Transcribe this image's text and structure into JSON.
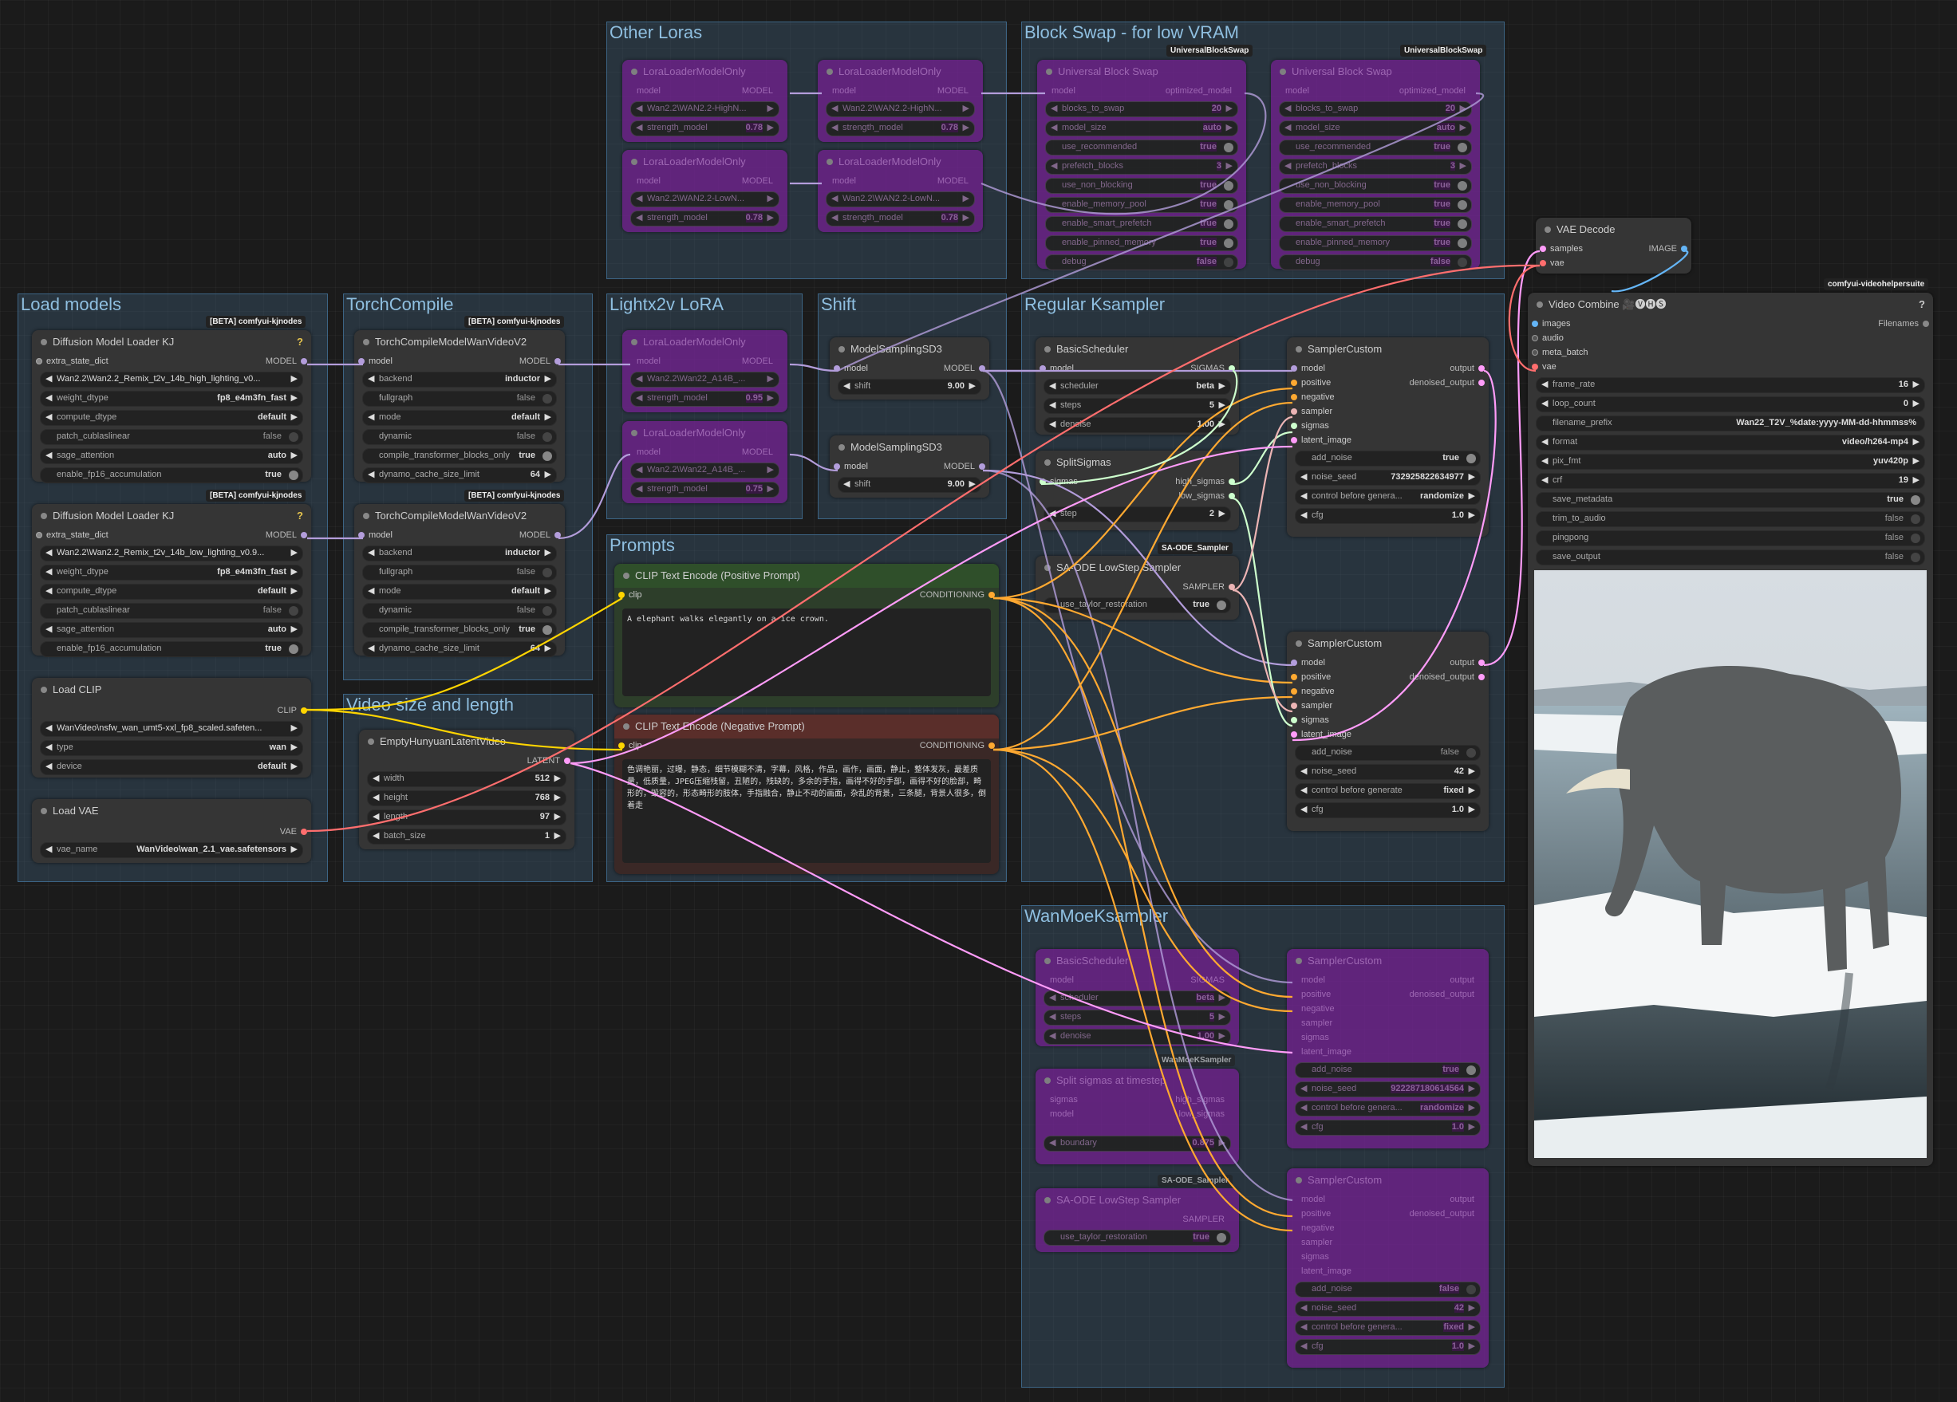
{
  "groups": {
    "other_loras": "Other Loras",
    "block_swap": "Block Swap - for low VRAM",
    "load_models": "Load models",
    "torch_compile": "TorchCompile",
    "lightx2v": "Lightx2v LoRA",
    "shift": "Shift",
    "regular_ksampler": "Regular Ksampler",
    "prompts": "Prompts",
    "video_size": "Video size and length",
    "wanmoe": "WanMoeKsampler"
  },
  "badges": {
    "kj": "[BETA] comfyui-kjnodes",
    "vhs": "comfyui-videohelpersuite",
    "ubs": "UniversalBlockSwap",
    "sa_ode": "SA-ODE_Sampler",
    "wanmoe": "WanMoeKSampler"
  },
  "sockets": {
    "model": "model",
    "MODEL": "MODEL",
    "clip": "clip",
    "CLIP": "CLIP",
    "vae": "vae",
    "VAE": "VAE",
    "LATENT": "LATENT",
    "CONDITIONING": "CONDITIONING",
    "SIGMAS": "SIGMAS",
    "SAMPLER": "SAMPLER",
    "IMAGE": "IMAGE",
    "samples": "samples",
    "sigmas": "sigmas",
    "output": "output",
    "denoised_output": "denoised_output",
    "positive": "positive",
    "negative": "negative",
    "sampler": "sampler",
    "latent_image": "latent_image",
    "optimized_model": "optimized_model",
    "extra_state_dict": "extra_state_dict",
    "high_sigmas": "high_sigmas",
    "low_sigmas": "low_sigmas",
    "images": "images",
    "audio": "audio",
    "meta_batch": "meta_batch",
    "Filenames": "Filenames"
  },
  "lora_loader": {
    "title": "LoraLoaderModelOnly",
    "n1": "Wan2.2\\WAN2.2-HighN...",
    "n2": "Wan2.2\\WAN2.2-LowN...",
    "strength_label": "strength_model",
    "s1": "0.78",
    "s2": "0.78"
  },
  "lightx2v": {
    "title": "LoraLoaderModelOnly",
    "n1": "Wan2.2\\Wan22_A14B_...",
    "n2": "Wan2.2\\Wan22_A14B_...",
    "strength_label": "strength_model",
    "s1": "0.95",
    "s2": "0.75"
  },
  "block_swap": {
    "title": "Universal Block Swap",
    "blocks_to_swap": "blocks_to_swap",
    "bts_val": "20",
    "model_size": "model_size",
    "model_size_val": "auto",
    "use_recommended": "use_recommended",
    "prefetch_blocks": "prefetch_blocks",
    "prefetch_val": "3",
    "use_non_blocking": "use_non_blocking",
    "enable_memory_pool": "enable_memory_pool",
    "enable_smart_prefetch": "enable_smart_prefetch",
    "enable_pinned_memory": "enable_pinned_memory",
    "debug": "debug",
    "true": "true",
    "false": "false"
  },
  "dml1": {
    "title": "Diffusion Model Loader KJ",
    "model": "Wan2.2\\Wan2.2_Remix_t2v_14b_high_lighting_v0...",
    "weight_dtype": "fp8_e4m3fn_fast",
    "compute_dtype": "default",
    "patch_cublaslinear": "false",
    "sage_attention": "auto",
    "enable_fp16_accumulation": "true"
  },
  "dml2": {
    "title": "Diffusion Model Loader KJ",
    "model": "Wan2.2\\Wan2.2_Remix_t2v_14b_low_lighting_v0.9...",
    "weight_dtype": "fp8_e4m3fn_fast",
    "compute_dtype": "default",
    "patch_cublaslinear": "false",
    "sage_attention": "auto",
    "enable_fp16_accumulation": "true"
  },
  "labels": {
    "weight_dtype": "weight_dtype",
    "compute_dtype": "compute_dtype",
    "patch_cublaslinear": "patch_cublaslinear",
    "sage_attention": "sage_attention",
    "enable_fp16_accumulation": "enable_fp16_accumulation",
    "backend": "backend",
    "fullgraph": "fullgraph",
    "mode": "mode",
    "dynamic": "dynamic",
    "compile_transformer_blocks_only": "compile_transformer_blocks_only",
    "dynamo_cache_size_limit": "dynamo_cache_size_limit",
    "type": "type",
    "device": "device",
    "vae_name": "vae_name",
    "width": "width",
    "height": "height",
    "length": "length",
    "batch_size": "batch_size",
    "shift": "shift",
    "scheduler": "scheduler",
    "steps": "steps",
    "denoise": "denoise",
    "step": "step",
    "use_taylor_restoration": "use_taylor_restoration",
    "add_noise": "add_noise",
    "noise_seed": "noise_seed",
    "control_before_generate": "control before genera...",
    "control_before_generate_full": "control before generate",
    "cfg": "cfg",
    "frame_rate": "frame_rate",
    "loop_count": "loop_count",
    "filename_prefix": "filename_prefix",
    "format": "format",
    "pix_fmt": "pix_fmt",
    "crf": "crf",
    "save_metadata": "save_metadata",
    "trim_to_audio": "trim_to_audio",
    "pingpong": "pingpong",
    "save_output": "save_output",
    "boundary": "boundary"
  },
  "tc": {
    "title": "TorchCompileModelWanVideoV2",
    "backend": "inductor",
    "fullgraph": "false",
    "mode": "default",
    "dynamic": "false",
    "ctbo": "true",
    "dcsl": "64"
  },
  "load_clip": {
    "title": "Load CLIP",
    "clip_name": "WanVideo\\nsfw_wan_umt5-xxl_fp8_scaled.safeten...",
    "type": "wan",
    "device": "default"
  },
  "load_vae": {
    "title": "Load VAE",
    "vae_name": "WanVideo\\wan_2.1_vae.safetensors"
  },
  "latent": {
    "title": "EmptyHunyuanLatentVideo",
    "width": "512",
    "height": "768",
    "length": "97",
    "batch_size": "1"
  },
  "ms1": {
    "title": "ModelSamplingSD3",
    "shift": "9.00"
  },
  "ms2": {
    "title": "ModelSamplingSD3",
    "shift": "9.00"
  },
  "pos": {
    "title": "CLIP Text Encode (Positive Prompt)",
    "text": "A elephant walks elegantly on a ice crown."
  },
  "neg": {
    "title": "CLIP Text Encode (Negative Prompt)",
    "text": "色调艳丽，过曝，静态，细节模糊不清，字幕，风格，作品，画作，画面，静止，整体发灰，最差质量，低质量，JPEG压缩残留，丑陋的，残缺的，多余的手指，画得不好的手部，画得不好的脸部，畸形的，毁容的，形态畸形的肢体，手指融合，静止不动的画面，杂乱的背景，三条腿，背景人很多，倒着走"
  },
  "sched": {
    "title": "BasicScheduler",
    "scheduler": "beta",
    "steps": "5",
    "denoise": "1.00"
  },
  "split": {
    "title": "SplitSigmas",
    "step": "2"
  },
  "saode": {
    "title": "SA-ODE LowStep Sampler",
    "taylor": "true"
  },
  "sc1": {
    "title": "SamplerCustom",
    "add_noise": "true",
    "noise_seed": "732925822634977",
    "control": "randomize",
    "cfg": "1.0"
  },
  "sc2": {
    "title": "SamplerCustom",
    "add_noise": "false",
    "noise_seed": "42",
    "control": "fixed",
    "cfg": "1.0"
  },
  "vae_decode": {
    "title": "VAE Decode"
  },
  "vc": {
    "title": "Video Combine 🎥🅥🅗🅢",
    "frame_rate": "16",
    "loop_count": "0",
    "filename_prefix": "Wan22_T2V_%date:yyyy-MM-dd-hhmmss%",
    "format": "video/h264-mp4",
    "pix_fmt": "yuv420p",
    "crf": "19",
    "save_metadata": "true",
    "trim_to_audio": "false",
    "pingpong": "false",
    "save_output": "false"
  },
  "wm": {
    "sched_title": "BasicScheduler",
    "split_title": "Split sigmas at timestep",
    "boundary": "0.875",
    "saode_title": "SA-ODE LowStep Sampler",
    "sc_title": "SamplerCustom",
    "sc1_seed": "922287180614564",
    "sc1_control": "randomize",
    "sc1_add": "true",
    "sc2_add": "false",
    "sc2_seed": "42",
    "sc2_control": "fixed",
    "scheduler": "beta",
    "steps": "5",
    "denoise": "1.00",
    "cfg": "1.0"
  },
  "colors": {
    "model": "#b39ddb",
    "clip": "#ffd500",
    "vae": "#ff6e6e",
    "latent": "#ff9cf9",
    "conditioning": "#ffa931",
    "sigmas": "#cdffcd",
    "sampler": "#ecb4b4",
    "image": "#64b5f6"
  }
}
